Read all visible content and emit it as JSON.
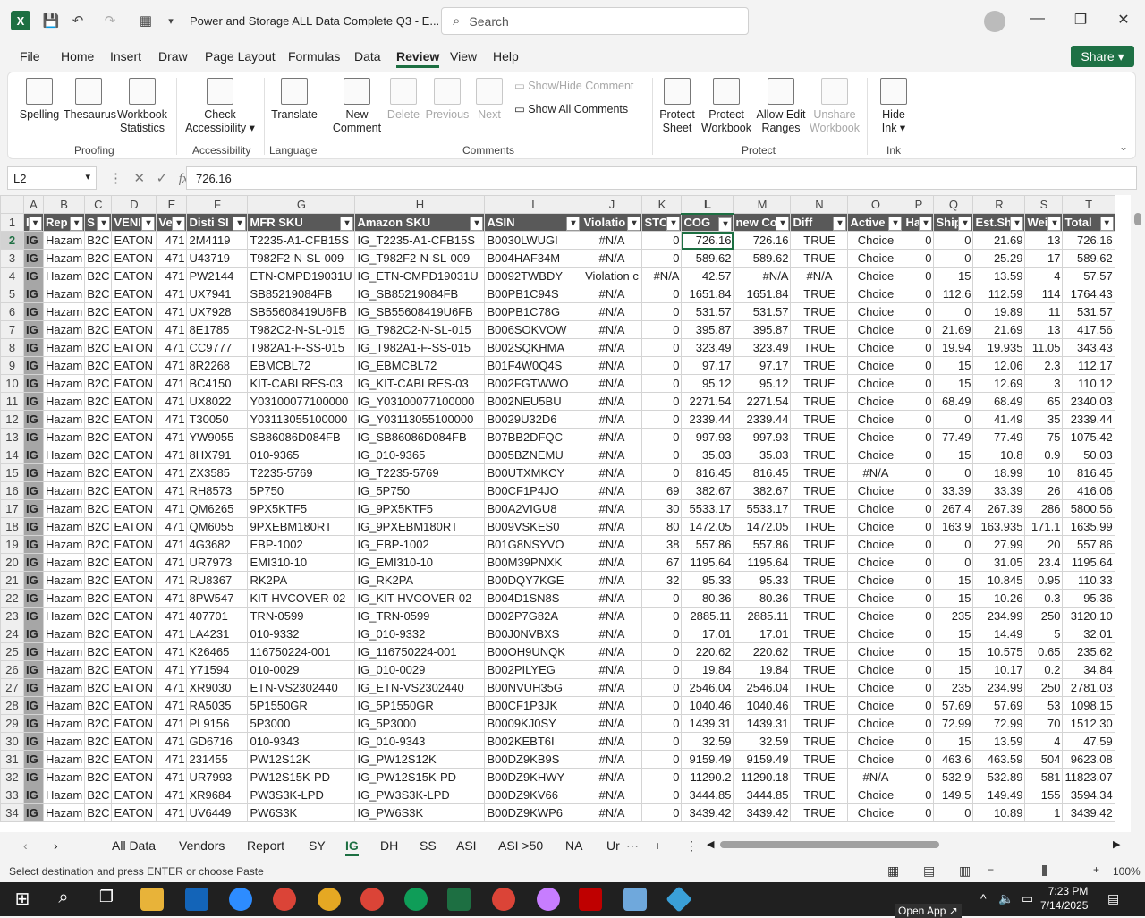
{
  "titlebar": {
    "title": "Power and Storage ALL Data Complete Q3  -  E...",
    "search_placeholder": "Search"
  },
  "menu": [
    "File",
    "Home",
    "Insert",
    "Draw",
    "Page Layout",
    "Formulas",
    "Data",
    "Review",
    "View",
    "Help"
  ],
  "share_label": "Share",
  "ribbon": {
    "spelling": "Spelling",
    "thesaurus": "Thesaurus",
    "workbook_stats_1": "Workbook",
    "workbook_stats_2": "Statistics",
    "proofing": "Proofing",
    "check_acc_1": "Check",
    "check_acc_2": "Accessibility ▾",
    "accessibility": "Accessibility",
    "translate": "Translate",
    "language": "Language",
    "new_comment_1": "New",
    "new_comment_2": "Comment",
    "delete": "Delete",
    "previous": "Previous",
    "next": "Next",
    "show_hide_comment": "Show/Hide Comment",
    "show_all_comments": "Show All Comments",
    "comments": "Comments",
    "protect_sheet_1": "Protect",
    "protect_sheet_2": "Sheet",
    "protect_wb_1": "Protect",
    "protect_wb_2": "Workbook",
    "allow_edit_1": "Allow Edit",
    "allow_edit_2": "Ranges",
    "unshare_1": "Unshare",
    "unshare_2": "Workbook",
    "protect": "Protect",
    "hide_ink_1": "Hide",
    "hide_ink_2": "Ink ▾",
    "ink": "Ink"
  },
  "formula_bar": {
    "cell_ref": "L2",
    "value": "726.16"
  },
  "columns": [
    "A",
    "B",
    "C",
    "D",
    "E",
    "F",
    "G",
    "H",
    "I",
    "J",
    "K",
    "L",
    "M",
    "N",
    "O",
    "P",
    "Q",
    "R",
    "S",
    "T"
  ],
  "headers": [
    "I",
    "Rep",
    "S",
    "VENI",
    "Ve",
    "Disti SI",
    "MFR SKU",
    "Amazon SKU",
    "ASIN",
    "Violatio",
    "STO",
    "COG",
    "new Co",
    "Diff",
    "Active",
    "Han",
    "Ship",
    "Est.Shi",
    "Wei",
    "Total"
  ],
  "rows": [
    [
      "IG",
      "Hazam",
      "B2C",
      "EATON",
      "471",
      "2M4119",
      "T2235-A1-CFB15S",
      "IG_T2235-A1-CFB15S",
      "B0030LWUGI",
      "#N/A",
      "0",
      "726.16",
      "726.16",
      "TRUE",
      "Choice",
      "0",
      "0",
      "21.69",
      "13",
      "726.16"
    ],
    [
      "IG",
      "Hazam",
      "B2C",
      "EATON",
      "471",
      "U43719",
      "T982F2-N-SL-009",
      "IG_T982F2-N-SL-009",
      "B004HAF34M",
      "#N/A",
      "0",
      "589.62",
      "589.62",
      "TRUE",
      "Choice",
      "0",
      "0",
      "25.29",
      "17",
      "589.62"
    ],
    [
      "IG",
      "Hazam",
      "B2C",
      "EATON",
      "471",
      "PW2144",
      "ETN-CMPD19031U",
      "IG_ETN-CMPD19031U",
      "B0092TWBDY",
      "Violation c",
      "#N/A",
      "42.57",
      "#N/A",
      "#N/A",
      "Choice",
      "0",
      "15",
      "13.59",
      "4",
      "57.57"
    ],
    [
      "IG",
      "Hazam",
      "B2C",
      "EATON",
      "471",
      "UX7941",
      "SB85219084FB",
      "IG_SB85219084FB",
      "B00PB1C94S",
      "#N/A",
      "0",
      "1651.84",
      "1651.84",
      "TRUE",
      "Choice",
      "0",
      "112.6",
      "112.59",
      "114",
      "1764.43"
    ],
    [
      "IG",
      "Hazam",
      "B2C",
      "EATON",
      "471",
      "UX7928",
      "SB55608419U6FB",
      "IG_SB55608419U6FB",
      "B00PB1C78G",
      "#N/A",
      "0",
      "531.57",
      "531.57",
      "TRUE",
      "Choice",
      "0",
      "0",
      "19.89",
      "11",
      "531.57"
    ],
    [
      "IG",
      "Hazam",
      "B2C",
      "EATON",
      "471",
      "8E1785",
      "T982C2-N-SL-015",
      "IG_T982C2-N-SL-015",
      "B006SOKVOW",
      "#N/A",
      "0",
      "395.87",
      "395.87",
      "TRUE",
      "Choice",
      "0",
      "21.69",
      "21.69",
      "13",
      "417.56"
    ],
    [
      "IG",
      "Hazam",
      "B2C",
      "EATON",
      "471",
      "CC9777",
      "T982A1-F-SS-015",
      "IG_T982A1-F-SS-015",
      "B002SQKHMA",
      "#N/A",
      "0",
      "323.49",
      "323.49",
      "TRUE",
      "Choice",
      "0",
      "19.94",
      "19.935",
      "11.05",
      "343.43"
    ],
    [
      "IG",
      "Hazam",
      "B2C",
      "EATON",
      "471",
      "8R2268",
      "EBMCBL72",
      "IG_EBMCBL72",
      "B01F4W0Q4S",
      "#N/A",
      "0",
      "97.17",
      "97.17",
      "TRUE",
      "Choice",
      "0",
      "15",
      "12.06",
      "2.3",
      "112.17"
    ],
    [
      "IG",
      "Hazam",
      "B2C",
      "EATON",
      "471",
      "BC4150",
      "KIT-CABLRES-03",
      "IG_KIT-CABLRES-03",
      "B002FGTWWO",
      "#N/A",
      "0",
      "95.12",
      "95.12",
      "TRUE",
      "Choice",
      "0",
      "15",
      "12.69",
      "3",
      "110.12"
    ],
    [
      "IG",
      "Hazam",
      "B2C",
      "EATON",
      "471",
      "UX8022",
      "Y03100077100000",
      "IG_Y03100077100000",
      "B002NEU5BU",
      "#N/A",
      "0",
      "2271.54",
      "2271.54",
      "TRUE",
      "Choice",
      "0",
      "68.49",
      "68.49",
      "65",
      "2340.03"
    ],
    [
      "IG",
      "Hazam",
      "B2C",
      "EATON",
      "471",
      "T30050",
      "Y03113055100000",
      "IG_Y03113055100000",
      "B0029U32D6",
      "#N/A",
      "0",
      "2339.44",
      "2339.44",
      "TRUE",
      "Choice",
      "0",
      "0",
      "41.49",
      "35",
      "2339.44"
    ],
    [
      "IG",
      "Hazam",
      "B2C",
      "EATON",
      "471",
      "YW9055",
      "SB86086D084FB",
      "IG_SB86086D084FB",
      "B07BB2DFQC",
      "#N/A",
      "0",
      "997.93",
      "997.93",
      "TRUE",
      "Choice",
      "0",
      "77.49",
      "77.49",
      "75",
      "1075.42"
    ],
    [
      "IG",
      "Hazam",
      "B2C",
      "EATON",
      "471",
      "8HX791",
      "010-9365",
      "IG_010-9365",
      "B005BZNEMU",
      "#N/A",
      "0",
      "35.03",
      "35.03",
      "TRUE",
      "Choice",
      "0",
      "15",
      "10.8",
      "0.9",
      "50.03"
    ],
    [
      "IG",
      "Hazam",
      "B2C",
      "EATON",
      "471",
      "ZX3585",
      "T2235-5769",
      "IG_T2235-5769",
      "B00UTXMKCY",
      "#N/A",
      "0",
      "816.45",
      "816.45",
      "TRUE",
      "#N/A",
      "0",
      "0",
      "18.99",
      "10",
      "816.45"
    ],
    [
      "IG",
      "Hazam",
      "B2C",
      "EATON",
      "471",
      "RH8573",
      "5P750",
      "IG_5P750",
      "B00CF1P4JO",
      "#N/A",
      "69",
      "382.67",
      "382.67",
      "TRUE",
      "Choice",
      "0",
      "33.39",
      "33.39",
      "26",
      "416.06"
    ],
    [
      "IG",
      "Hazam",
      "B2C",
      "EATON",
      "471",
      "QM6265",
      "9PX5KTF5",
      "IG_9PX5KTF5",
      "B00A2VIGU8",
      "#N/A",
      "30",
      "5533.17",
      "5533.17",
      "TRUE",
      "Choice",
      "0",
      "267.4",
      "267.39",
      "286",
      "5800.56"
    ],
    [
      "IG",
      "Hazam",
      "B2C",
      "EATON",
      "471",
      "QM6055",
      "9PXEBM180RT",
      "IG_9PXEBM180RT",
      "B009VSKES0",
      "#N/A",
      "80",
      "1472.05",
      "1472.05",
      "TRUE",
      "Choice",
      "0",
      "163.9",
      "163.935",
      "171.1",
      "1635.99"
    ],
    [
      "IG",
      "Hazam",
      "B2C",
      "EATON",
      "471",
      "4G3682",
      "EBP-1002",
      "IG_EBP-1002",
      "B01G8NSYVO",
      "#N/A",
      "38",
      "557.86",
      "557.86",
      "TRUE",
      "Choice",
      "0",
      "0",
      "27.99",
      "20",
      "557.86"
    ],
    [
      "IG",
      "Hazam",
      "B2C",
      "EATON",
      "471",
      "UR7973",
      "EMI310-10",
      "IG_EMI310-10",
      "B00M39PNXK",
      "#N/A",
      "67",
      "1195.64",
      "1195.64",
      "TRUE",
      "Choice",
      "0",
      "0",
      "31.05",
      "23.4",
      "1195.64"
    ],
    [
      "IG",
      "Hazam",
      "B2C",
      "EATON",
      "471",
      "RU8367",
      "RK2PA",
      "IG_RK2PA",
      "B00DQY7KGE",
      "#N/A",
      "32",
      "95.33",
      "95.33",
      "TRUE",
      "Choice",
      "0",
      "15",
      "10.845",
      "0.95",
      "110.33"
    ],
    [
      "IG",
      "Hazam",
      "B2C",
      "EATON",
      "471",
      "8PW547",
      "KIT-HVCOVER-02",
      "IG_KIT-HVCOVER-02",
      "B004D1SN8S",
      "#N/A",
      "0",
      "80.36",
      "80.36",
      "TRUE",
      "Choice",
      "0",
      "15",
      "10.26",
      "0.3",
      "95.36"
    ],
    [
      "IG",
      "Hazam",
      "B2C",
      "EATON",
      "471",
      "407701",
      "TRN-0599",
      "IG_TRN-0599",
      "B002P7G82A",
      "#N/A",
      "0",
      "2885.11",
      "2885.11",
      "TRUE",
      "Choice",
      "0",
      "235",
      "234.99",
      "250",
      "3120.10"
    ],
    [
      "IG",
      "Hazam",
      "B2C",
      "EATON",
      "471",
      "LA4231",
      "010-9332",
      "IG_010-9332",
      "B00J0NVBXS",
      "#N/A",
      "0",
      "17.01",
      "17.01",
      "TRUE",
      "Choice",
      "0",
      "15",
      "14.49",
      "5",
      "32.01"
    ],
    [
      "IG",
      "Hazam",
      "B2C",
      "EATON",
      "471",
      "K26465",
      "116750224-001",
      "IG_116750224-001",
      "B00OH9UNQK",
      "#N/A",
      "0",
      "220.62",
      "220.62",
      "TRUE",
      "Choice",
      "0",
      "15",
      "10.575",
      "0.65",
      "235.62"
    ],
    [
      "IG",
      "Hazam",
      "B2C",
      "EATON",
      "471",
      "Y71594",
      "010-0029",
      "IG_010-0029",
      "B002PILYEG",
      "#N/A",
      "0",
      "19.84",
      "19.84",
      "TRUE",
      "Choice",
      "0",
      "15",
      "10.17",
      "0.2",
      "34.84"
    ],
    [
      "IG",
      "Hazam",
      "B2C",
      "EATON",
      "471",
      "XR9030",
      "ETN-VS2302440",
      "IG_ETN-VS2302440",
      "B00NVUH35G",
      "#N/A",
      "0",
      "2546.04",
      "2546.04",
      "TRUE",
      "Choice",
      "0",
      "235",
      "234.99",
      "250",
      "2781.03"
    ],
    [
      "IG",
      "Hazam",
      "B2C",
      "EATON",
      "471",
      "RA5035",
      "5P1550GR",
      "IG_5P1550GR",
      "B00CF1P3JK",
      "#N/A",
      "0",
      "1040.46",
      "1040.46",
      "TRUE",
      "Choice",
      "0",
      "57.69",
      "57.69",
      "53",
      "1098.15"
    ],
    [
      "IG",
      "Hazam",
      "B2C",
      "EATON",
      "471",
      "PL9156",
      "5P3000",
      "IG_5P3000",
      "B0009KJ0SY",
      "#N/A",
      "0",
      "1439.31",
      "1439.31",
      "TRUE",
      "Choice",
      "0",
      "72.99",
      "72.99",
      "70",
      "1512.30"
    ],
    [
      "IG",
      "Hazam",
      "B2C",
      "EATON",
      "471",
      "GD6716",
      "010-9343",
      "IG_010-9343",
      "B002KEBT6I",
      "#N/A",
      "0",
      "32.59",
      "32.59",
      "TRUE",
      "Choice",
      "0",
      "15",
      "13.59",
      "4",
      "47.59"
    ],
    [
      "IG",
      "Hazam",
      "B2C",
      "EATON",
      "471",
      "231455",
      "PW12S12K",
      "IG_PW12S12K",
      "B00DZ9KB9S",
      "#N/A",
      "0",
      "9159.49",
      "9159.49",
      "TRUE",
      "Choice",
      "0",
      "463.6",
      "463.59",
      "504",
      "9623.08"
    ],
    [
      "IG",
      "Hazam",
      "B2C",
      "EATON",
      "471",
      "UR7993",
      "PW12S15K-PD",
      "IG_PW12S15K-PD",
      "B00DZ9KHWY",
      "#N/A",
      "0",
      "11290.2",
      "11290.18",
      "TRUE",
      "#N/A",
      "0",
      "532.9",
      "532.89",
      "581",
      "11823.07"
    ],
    [
      "IG",
      "Hazam",
      "B2C",
      "EATON",
      "471",
      "XR9684",
      "PW3S3K-LPD",
      "IG_PW3S3K-LPD",
      "B00DZ9KV66",
      "#N/A",
      "0",
      "3444.85",
      "3444.85",
      "TRUE",
      "Choice",
      "0",
      "149.5",
      "149.49",
      "155",
      "3594.34"
    ],
    [
      "IG",
      "Hazam",
      "B2C",
      "EATON",
      "471",
      "UV6449",
      "PW6S3K",
      "IG_PW6S3K",
      "B00DZ9KWP6",
      "#N/A",
      "0",
      "3439.42",
      "3439.42",
      "TRUE",
      "Choice",
      "0",
      "0",
      "10.89",
      "1",
      "3439.42"
    ]
  ],
  "sheets": [
    "All Data",
    "Vendors",
    "Report",
    "SY",
    "IG",
    "DH",
    "SS",
    "ASI",
    "ASI >50",
    "NA",
    "Ur"
  ],
  "active_sheet": "IG",
  "status_text": "Select destination and press ENTER or choose Paste",
  "zoom": "100%",
  "taskbar": {
    "time": "7:23 PM",
    "date": "7/14/2025",
    "open_app": "Open App"
  }
}
